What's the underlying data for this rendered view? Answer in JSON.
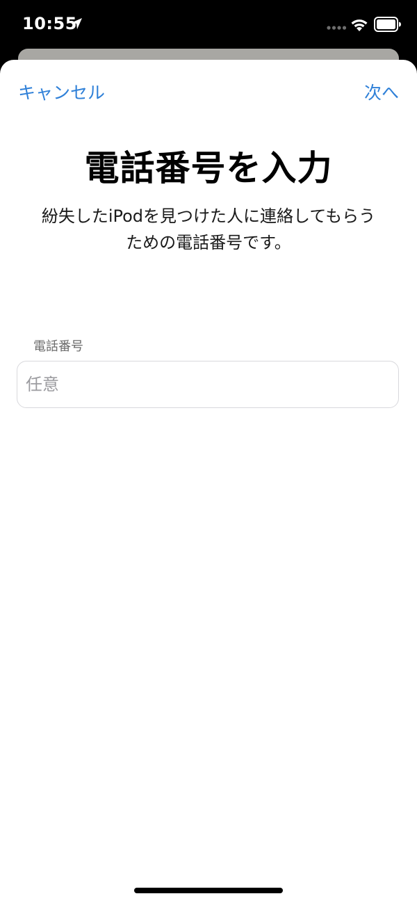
{
  "status_bar": {
    "time": "10:55",
    "icons": [
      "location-arrow-icon",
      "cellular-signal-icon",
      "wifi-icon",
      "battery-icon"
    ]
  },
  "nav": {
    "cancel_label": "キャンセル",
    "next_label": "次へ"
  },
  "content": {
    "title": "電話番号を入力",
    "description_line1": "紛失したiPodを見つけた人に連絡してもらう",
    "description_line2": "ための電話番号です。"
  },
  "phone_field": {
    "label": "電話番号",
    "value": "",
    "placeholder": "任意"
  },
  "colors": {
    "accent": "#2f80d8",
    "background": "#ffffff",
    "status_bar": "#000000"
  }
}
